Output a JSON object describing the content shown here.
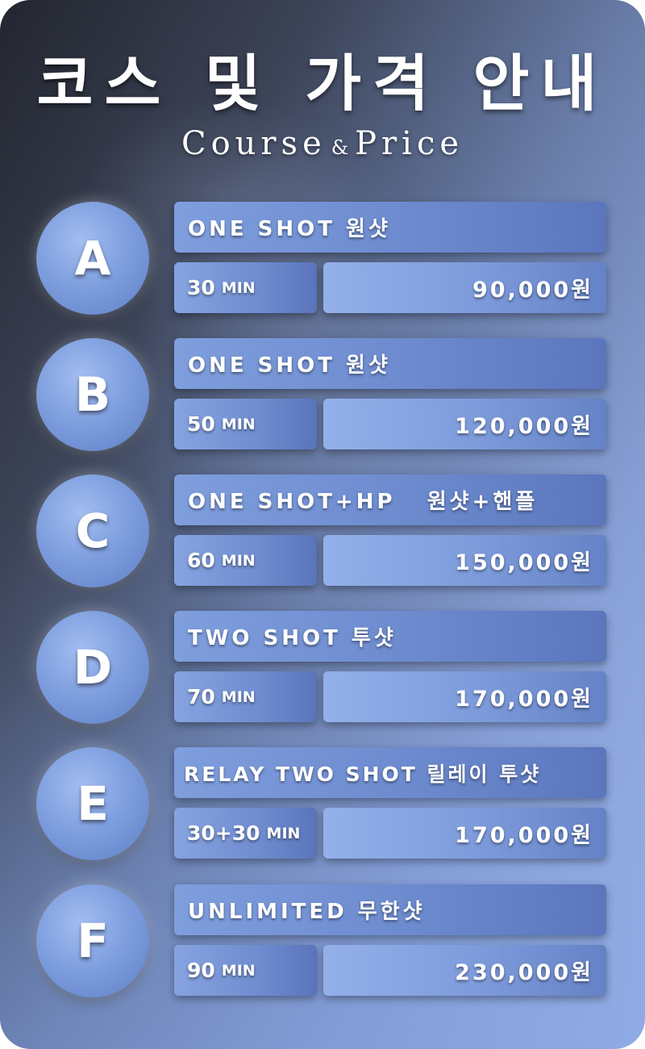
{
  "header": {
    "title": "코스 및 가격 안내",
    "subtitle_left": "Course",
    "subtitle_amp": "&",
    "subtitle_right": "Price"
  },
  "courses": [
    {
      "letter": "A",
      "name": "ONE SHOT 원샷",
      "duration": "30",
      "unit": "MIN",
      "price": "90,000원"
    },
    {
      "letter": "B",
      "name": "ONE SHOT 원샷",
      "duration": "50",
      "unit": "MIN",
      "price": "120,000원"
    },
    {
      "letter": "C",
      "name": "ONE SHOT+HP   원샷+핸플",
      "duration": "60",
      "unit": "MIN",
      "price": "150,000원"
    },
    {
      "letter": "D",
      "name": "TWO SHOT 투샷",
      "duration": "70",
      "unit": "MIN",
      "price": "170,000원"
    },
    {
      "letter": "E",
      "name": "RELAY TWO SHOT 릴레이 투샷",
      "duration": "30+30",
      "unit": "MIN",
      "price": "170,000원"
    },
    {
      "letter": "F",
      "name": "UNLIMITED 무한샷",
      "duration": "90",
      "unit": "MIN",
      "price": "230,000원"
    }
  ],
  "colors": {
    "badge": "#7f9fdf",
    "box": "#6c8ace",
    "text": "#ffffff"
  }
}
